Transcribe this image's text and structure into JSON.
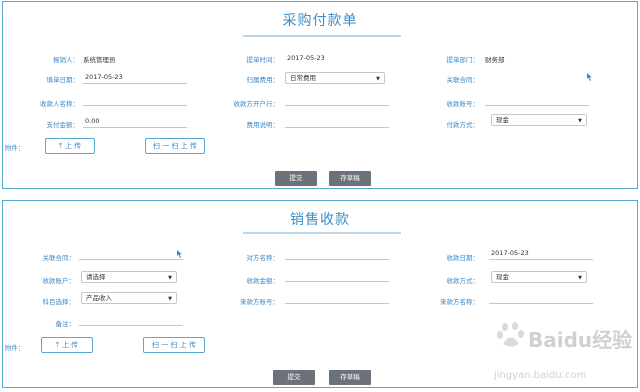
{
  "form1": {
    "title": "采购付款单",
    "reporter_label": "报销人：",
    "reporter_value": "系统管理员",
    "submit_time_label": "提单时间：",
    "submit_time_value": "2017-05-23",
    "department_label": "提单部门：",
    "department_value": "财务部",
    "fill_date_label": "填单日期：",
    "fill_date_value": "2017-05-23",
    "expense_type_label": "归属费用：",
    "expense_type_value": "日常费用",
    "contract_label": "关联合同：",
    "payee_name_label": "收款人名称：",
    "payee_bank_label": "收款方开户行：",
    "payee_account_label": "收款账号：",
    "amount_label": "支付金额：",
    "amount_value": "0.00",
    "expense_desc_label": "费用说明：",
    "pay_method_label": "付款方式：",
    "pay_method_value": "现金",
    "attachment_label": "附件：",
    "upload_label": "上 传",
    "scan_upload_label": "扫 一 扫 上 传",
    "submit_label": "提交",
    "draft_label": "存草稿"
  },
  "form2": {
    "title": "销售收款",
    "contract_label": "关联合同：",
    "counterparty_label": "对方名称：",
    "receipt_date_label": "收款日期：",
    "receipt_date_value": "2017-05-23",
    "receipt_account_label": "收款账户：",
    "receipt_account_value": "请选择",
    "receipt_amount_label": "收款金额：",
    "receipt_method_label": "收款方式：",
    "receipt_method_value": "现金",
    "subject_label": "科目选择：",
    "subject_value": "产品收入",
    "source_account_label": "来款方账号：",
    "source_name_label": "来款方名称：",
    "remark_label": "备注：",
    "attachment_label": "附件：",
    "upload_label": "上 传",
    "scan_upload_label": "扫 一 扫 上 传",
    "submit_label": "提交",
    "draft_label": "存草稿"
  },
  "watermark": {
    "brand": "Baidu经验",
    "url": "jingyan.baidu.com"
  }
}
